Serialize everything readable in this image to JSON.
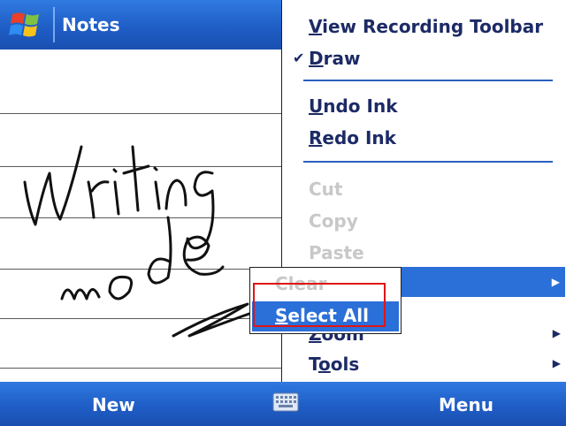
{
  "title_bar": {
    "app_title": "Notes",
    "start_icon": "windows-flag-icon"
  },
  "notes": {
    "ink_text": [
      "Writing",
      "mode"
    ]
  },
  "menu": {
    "items": [
      {
        "label": "View Recording Toolbar",
        "accel": "V",
        "checked": false,
        "enabled": true
      },
      {
        "label": "Draw",
        "accel": "D",
        "checked": true,
        "enabled": true
      },
      {
        "label": "Undo Ink",
        "accel": "U",
        "enabled": true
      },
      {
        "label": "Redo Ink",
        "accel": "R",
        "enabled": true
      },
      {
        "label": "Cut",
        "enabled": false
      },
      {
        "label": "Copy",
        "enabled": false
      },
      {
        "label": "Paste",
        "enabled": false
      },
      {
        "label": "",
        "highlighted": true,
        "has_submenu": true
      },
      {
        "label": "Zoom",
        "accel": "Z",
        "enabled": true,
        "has_submenu": true
      },
      {
        "label": "Tools",
        "accel": "o",
        "enabled": true,
        "has_submenu": true
      }
    ]
  },
  "submenu": {
    "items": [
      {
        "label": "Clear",
        "enabled": false
      },
      {
        "label": "Select All",
        "accel": "S",
        "selected": true
      }
    ]
  },
  "softkeys": {
    "left": "New",
    "right": "Menu",
    "center_icon": "keyboard-icon"
  },
  "colors": {
    "bar": "#1f5ec6",
    "highlight": "#2b6fd8",
    "menu_text": "#1c2a66",
    "disabled": "#c8c8c8",
    "annotation": "#e01515"
  }
}
